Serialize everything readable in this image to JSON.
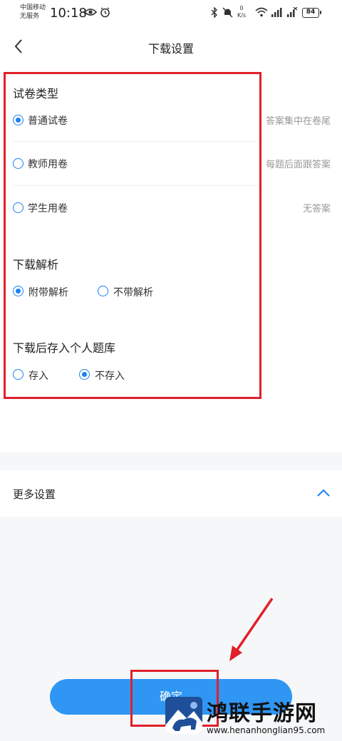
{
  "status_bar": {
    "carrier_line1": "中国移动",
    "carrier_line2": "无服务",
    "time": "10:18",
    "net_speed_value": "0",
    "net_speed_unit": "K/s",
    "battery": "84"
  },
  "header": {
    "title": "下载设置"
  },
  "sections": {
    "paper_type": {
      "title": "试卷类型",
      "options": [
        {
          "label": "普通试卷",
          "hint": "答案集中在卷尾",
          "checked": true
        },
        {
          "label": "教师用卷",
          "hint": "每题后面跟答案",
          "checked": false
        },
        {
          "label": "学生用卷",
          "hint": "无答案",
          "checked": false
        }
      ]
    },
    "analysis": {
      "title": "下载解析",
      "options": [
        {
          "label": "附带解析",
          "checked": true
        },
        {
          "label": "不带解析",
          "checked": false
        }
      ]
    },
    "save_to_bank": {
      "title": "下载后存入个人题库",
      "options": [
        {
          "label": "存入",
          "checked": false
        },
        {
          "label": "不存入",
          "checked": true
        }
      ]
    }
  },
  "more_settings": {
    "label": "更多设置"
  },
  "confirm": {
    "label": "确定"
  },
  "watermark": {
    "title": "鸿联手游网",
    "url": "www.henanhonglian95.com"
  },
  "colors": {
    "accent": "#1a82f2",
    "button": "#2f96f3",
    "annotation": "#e0202a"
  }
}
